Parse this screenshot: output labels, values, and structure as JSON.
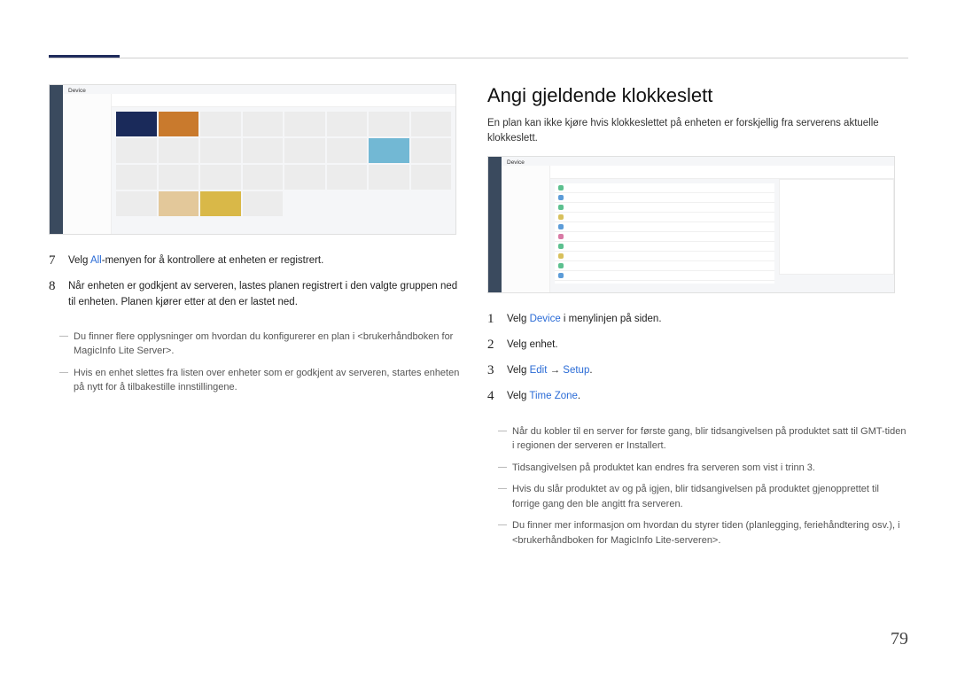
{
  "page_number": "79",
  "left": {
    "screenshot_label": "Device",
    "step7_num": "7",
    "step7_pre": "Velg ",
    "step7_link": "All",
    "step7_post": "-menyen for å kontrollere at enheten er registrert.",
    "step8_num": "8",
    "step8_text": "Når enheten er godkjent av serveren, lastes planen registrert i den valgte gruppen ned til enheten. Planen kjører etter at den er lastet ned.",
    "dash1": "Du finner flere opplysninger om hvordan du konfigurerer en plan i <brukerhåndboken for MagicInfo Lite Server>.",
    "dash2": "Hvis en enhet slettes fra listen over enheter som er godkjent av serveren, startes enheten på nytt for å tilbakestille innstillingene."
  },
  "right": {
    "heading": "Angi gjeldende klokkeslett",
    "intro": "En plan kan ikke kjøre hvis klokkeslettet på enheten er forskjellig fra serverens aktuelle klokkeslett.",
    "screenshot_label": "Device",
    "step1_num": "1",
    "step1_pre": "Velg ",
    "step1_link": "Device",
    "step1_post": " i menylinjen på siden.",
    "step2_num": "2",
    "step2_text": "Velg enhet.",
    "step3_num": "3",
    "step3_pre": "Velg ",
    "step3_link1": "Edit",
    "step3_arrow": " → ",
    "step3_link2": "Setup",
    "step3_post": ".",
    "step4_num": "4",
    "step4_pre": "Velg ",
    "step4_link": "Time Zone",
    "step4_post": ".",
    "dash1": "Når du kobler til en server for første gang, blir tidsangivelsen på produktet satt til GMT-tiden i regionen der serveren er Installert.",
    "dash2": "Tidsangivelsen på produktet kan endres fra serveren som vist i trinn 3.",
    "dash3": "Hvis du slår produktet av og på igjen, blir tidsangivelsen på produktet gjenopprettet til forrige gang den ble angitt fra serveren.",
    "dash4": "Du finner mer informasjon om hvordan du styrer tiden (planlegging, feriehåndtering osv.), i <brukerhåndboken for MagicInfo Lite-serveren>."
  }
}
